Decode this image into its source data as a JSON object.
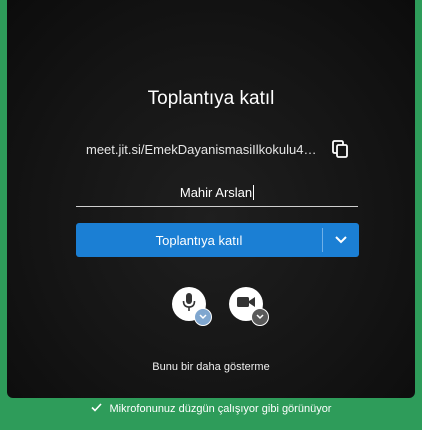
{
  "prejoin": {
    "title": "Toplantıya katıl",
    "meeting_url": "meet.jit.si/EmekDayanismasiIlkokulu4C...",
    "name_value": "Mahir Arslan",
    "join_label": "Toplantıya katıl",
    "dont_show_label": "Bunu bir daha gösterme"
  },
  "icons": {
    "copy": "copy-icon",
    "dropdown": "chevron-down-icon",
    "mic": "microphone-icon",
    "camera": "camera-icon",
    "check": "check-icon"
  },
  "status_bar": {
    "message": "Mikrofonunuz düzgün çalışıyor gibi görünüyor"
  },
  "colors": {
    "accent": "#1b7fd4",
    "status_bg": "#2e9c5a",
    "panel_bg": "#141414"
  }
}
